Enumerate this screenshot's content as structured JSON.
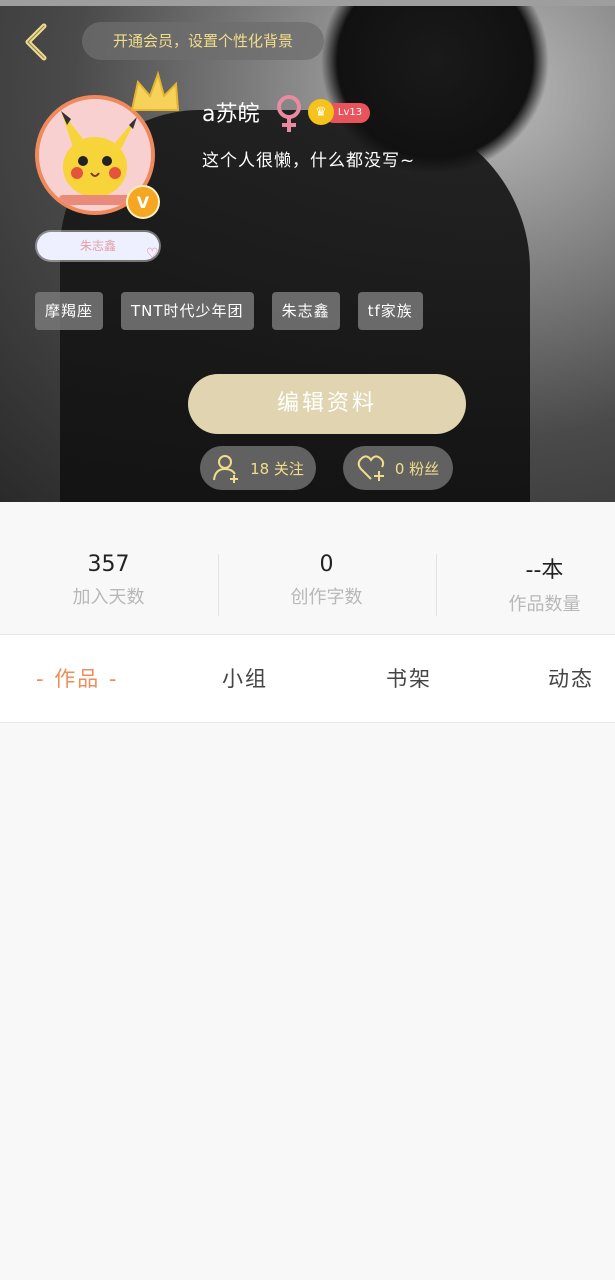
{
  "header": {
    "vip_banner": "开通会员，设置个性化背景",
    "username": "a苏皖",
    "level": "Lv13",
    "bio": "这个人很懒，什么都没写~",
    "fan_tag": "朱志鑫",
    "tags": [
      "摩羯座",
      "TNT时代少年团",
      "朱志鑫",
      "tf家族"
    ],
    "edit_button": "编辑资料",
    "following": "18 关注",
    "followers": "0 粉丝",
    "verified_badge": "V"
  },
  "stats": [
    {
      "value": "357",
      "label": "加入天数"
    },
    {
      "value": "0",
      "label": "创作字数"
    },
    {
      "value": "--本",
      "label": "作品数量"
    }
  ],
  "tabs": [
    {
      "label": "- 作品 -",
      "active": true
    },
    {
      "label": "小组",
      "active": false
    },
    {
      "label": "书架",
      "active": false
    },
    {
      "label": "动态",
      "active": false
    }
  ],
  "colors": {
    "accent": "#ee8e5a",
    "gold_text": "#f2dd8a",
    "edit_button": "#e0d5b0",
    "level_pill": "#e9545c",
    "female_symbol": "#e98aa1"
  },
  "icons": [
    "back-arrow-icon",
    "crown-icon",
    "female-symbol-icon",
    "level-crown-icon",
    "add-friend-icon",
    "heart-plus-icon"
  ]
}
